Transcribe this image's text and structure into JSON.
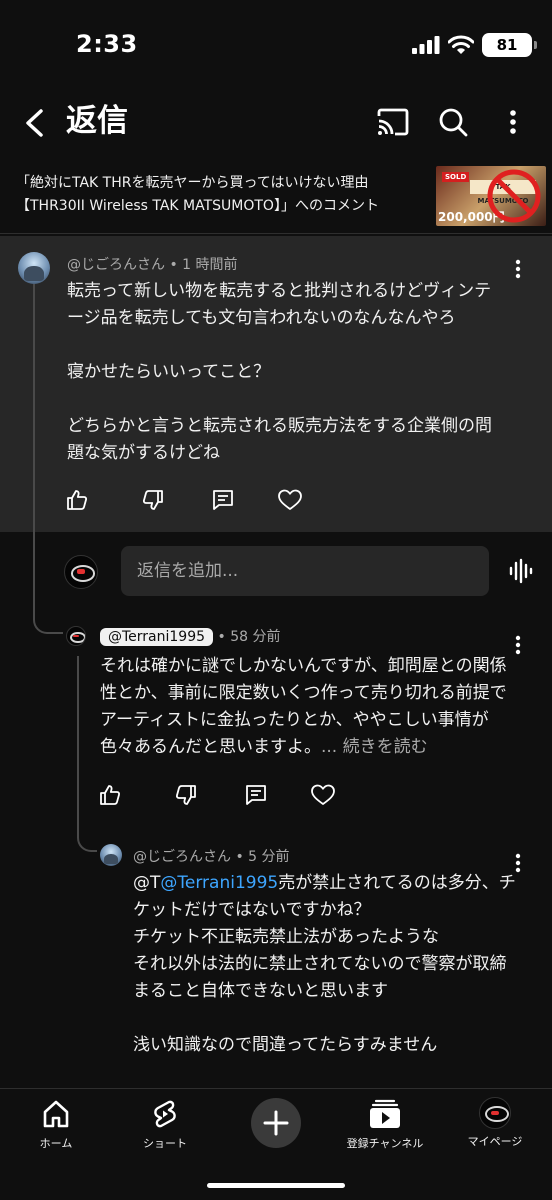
{
  "status_bar": {
    "time": "2:33",
    "battery": "81"
  },
  "header": {
    "title": "返信"
  },
  "video": {
    "line1": "「絶対にTAK THRを転売ヤーから買ってはいけない理由",
    "line2": "【THR30II Wireless TAK MATSUMOTO】」へのコメント",
    "thumb_sold": "SOLD",
    "thumb_banner": "TAK MATSUMOTO",
    "thumb_price": "200,000円"
  },
  "parent_comment": {
    "author": "@じごろんさん",
    "time": "1 時間前",
    "paragraphs": [
      "転売って新しい物を転売すると批判されるけどヴィンテージ品を転売しても文句言われないのなんなんやろ",
      "",
      "寝かせたらいいってこと？",
      "",
      "どちらかと言うと転売される販売方法をする企業側の問題な気がするけどね"
    ]
  },
  "reply_input": {
    "placeholder": "返信を追加..."
  },
  "reply1": {
    "author": "@Terrani1995",
    "time": "58 分前",
    "text": "それは確かに謎でしかないんですが、卸問屋との関係性とか、事前に限定数いくつ作って売り切れる前提でアーティストに金払ったりとか、ややこしい事情が色々あるんだと思いますよ。",
    "read_more": "... 続きを読む"
  },
  "reply2": {
    "author": "@じごろんさん",
    "time": "5 分前",
    "prefix": "@T",
    "mention": "@Terrani1995",
    "first_text": "売が禁止されてるのは多分、チケットだけではないですかね？",
    "lines": [
      "チケット不正転売禁止法があったような",
      "それ以外は法的に禁止されてないので警察が取締まること自体できないと思います",
      "",
      "浅い知識なので間違ってたらすみません"
    ]
  },
  "bottom_nav": {
    "home": "ホーム",
    "shorts": "ショート",
    "subscriptions": "登録チャンネル",
    "you": "マイページ"
  },
  "colors": {
    "background": "#0f0f0f",
    "card": "#272727",
    "link": "#3ea6ff",
    "meta": "#aaaaaa"
  },
  "icons": [
    "back-arrow-icon",
    "cast-icon",
    "search-icon",
    "more-vert-icon",
    "like-icon",
    "dislike-icon",
    "reply-icon",
    "heart-icon",
    "voice-icon",
    "home-icon",
    "shorts-icon",
    "plus-icon",
    "subscriptions-icon"
  ]
}
